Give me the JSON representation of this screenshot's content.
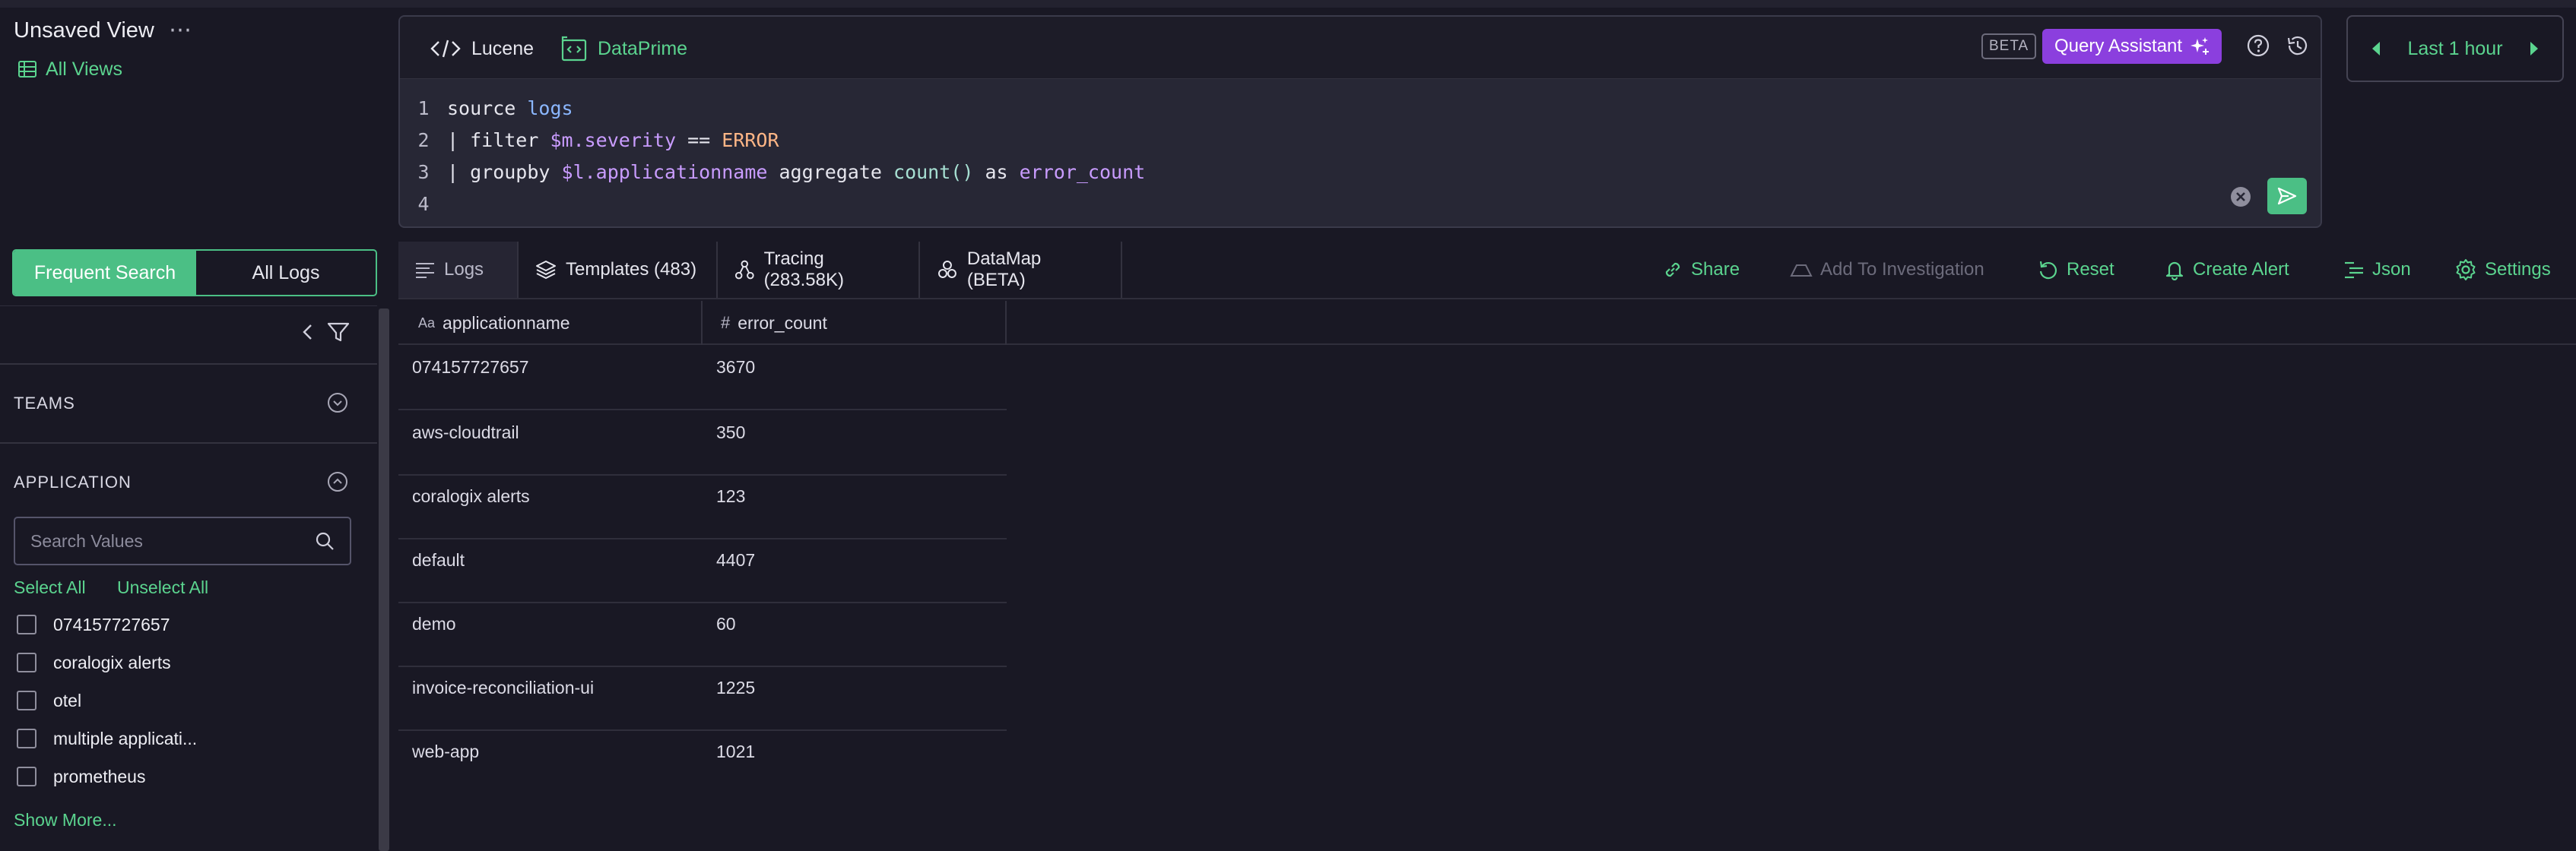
{
  "header": {
    "view_title": "Unsaved View",
    "more_label": "⋯",
    "all_views_label": "All Views"
  },
  "query": {
    "tabs": [
      {
        "label": "Lucene",
        "icon": "code-icon"
      },
      {
        "label": "DataPrime",
        "icon": "dataprime-icon"
      }
    ],
    "beta_badge": "BETA",
    "assistant_label": "Query Assistant",
    "line_numbers": [
      "1",
      "2",
      "3",
      "4"
    ],
    "lines": {
      "l1": {
        "a": "source ",
        "b": "logs"
      },
      "l2": {
        "a": "| filter ",
        "b": "$m.severity",
        "c": " == ",
        "d": "ERROR"
      },
      "l3": {
        "a": "| groupby ",
        "b": "$l.applicationname",
        "c": " aggregate ",
        "d": "count()",
        "e": " as ",
        "f": "error_count"
      }
    }
  },
  "time_range": {
    "label": "Last 1 hour"
  },
  "sidebar": {
    "frequent_search_label": "Frequent Search",
    "all_logs_label": "All Logs",
    "sections": {
      "teams": "TEAMS",
      "application": "APPLICATION"
    },
    "search_placeholder": "Search Values",
    "select_all": "Select All",
    "unselect_all": "Unselect All",
    "applications": [
      "074157727657",
      "coralogix alerts",
      "otel",
      "multiple applicati...",
      "prometheus"
    ],
    "show_more": "Show More..."
  },
  "results_tabs": {
    "logs": "Logs",
    "templates": "Templates (483)",
    "tracing": "Tracing (283.58K)",
    "datamap": "DataMap (BETA)"
  },
  "actions": {
    "share": "Share",
    "add_to_investigation": "Add To Investigation",
    "reset": "Reset",
    "create_alert": "Create Alert",
    "json": "Json",
    "settings": "Settings"
  },
  "table": {
    "columns": [
      "applicationname",
      "error_count"
    ],
    "column_type_marks": [
      "Aa",
      "#"
    ],
    "rows": [
      {
        "applicationname": "074157727657",
        "error_count": "3670"
      },
      {
        "applicationname": "aws-cloudtrail",
        "error_count": "350"
      },
      {
        "applicationname": "coralogix alerts",
        "error_count": "123"
      },
      {
        "applicationname": "default",
        "error_count": "4407"
      },
      {
        "applicationname": "demo",
        "error_count": "60"
      },
      {
        "applicationname": "invoice-reconciliation-ui",
        "error_count": "1225"
      },
      {
        "applicationname": "web-app",
        "error_count": "1021"
      }
    ]
  },
  "colors": {
    "accent_green": "#4bbf85",
    "assistant_purple": "#8b3fde",
    "background": "#191824"
  }
}
